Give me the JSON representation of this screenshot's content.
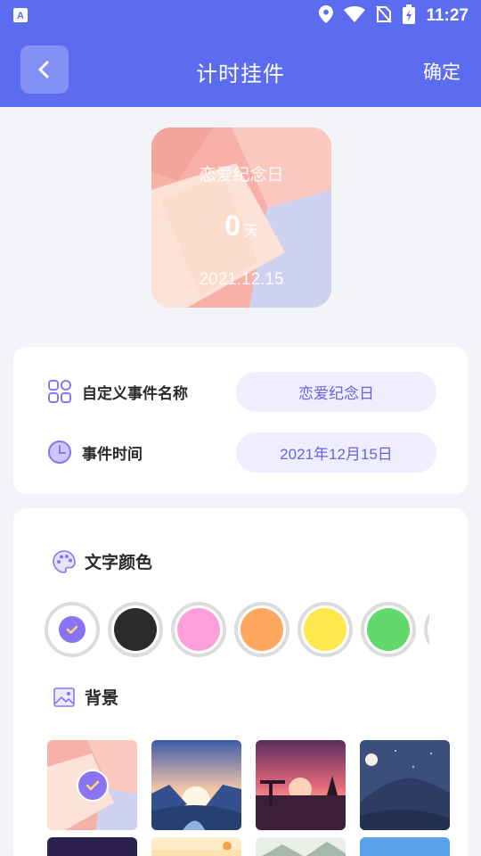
{
  "status_bar": {
    "time": "11:27"
  },
  "app_bar": {
    "title": "计时挂件",
    "confirm_label": "确定",
    "back_icon": "chevron-left-icon"
  },
  "preview": {
    "event_name": "恋爱纪念日",
    "days": "0",
    "days_unit": "天",
    "date": "2021.12.15"
  },
  "form": {
    "name_label": "自定义事件名称",
    "name_value": "恋爱纪念日",
    "time_label": "事件时间",
    "time_value": "2021年12月15日"
  },
  "text_color": {
    "title": "文字颜色",
    "swatches": [
      {
        "color": "#ffffff",
        "selected": true
      },
      {
        "color": "#2b2b2b",
        "selected": false
      },
      {
        "color": "#ff9fd9",
        "selected": false
      },
      {
        "color": "#ffa860",
        "selected": false
      },
      {
        "color": "#ffe74e",
        "selected": false
      },
      {
        "color": "#63d86c",
        "selected": false
      }
    ]
  },
  "background": {
    "title": "背景",
    "selected_index": 0
  },
  "colors": {
    "primary": "#5b6cf0",
    "accent": "#8a73f5",
    "pill_bg": "#eeeefe",
    "pill_text": "#6d5fe0"
  }
}
